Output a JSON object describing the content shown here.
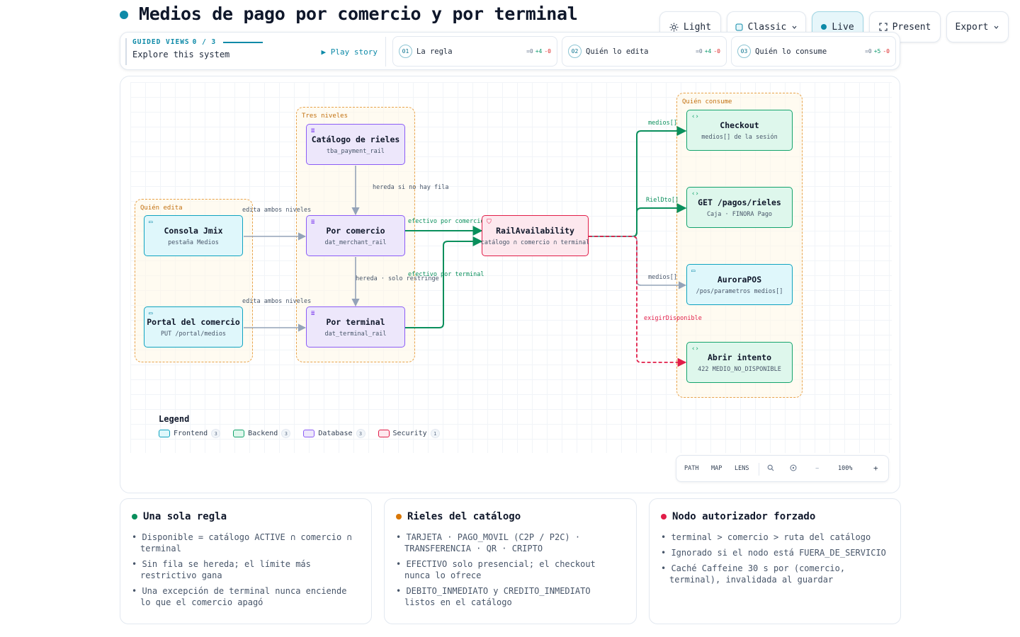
{
  "header": {
    "title": "Medios de pago por comercio y por terminal",
    "accent_color": "#0e8aa8"
  },
  "toolbar": {
    "light": "Light",
    "classic": "Classic",
    "live": "Live",
    "present": "Present",
    "export": "Export"
  },
  "guided": {
    "kicker": "GUIDED VIEWS",
    "progress": "0 / 3",
    "subtitle": "Explore this system",
    "play": "Play story",
    "steps": [
      {
        "num": "01",
        "label": "La regla",
        "eq": "=0",
        "plus": "+4",
        "minus": "-0"
      },
      {
        "num": "02",
        "label": "Quién lo edita",
        "eq": "=0",
        "plus": "+4",
        "minus": "-0"
      },
      {
        "num": "03",
        "label": "Quién lo consume",
        "eq": "=0",
        "plus": "+5",
        "minus": "-0"
      }
    ]
  },
  "diagram": {
    "groups": {
      "editors": "Quién edita",
      "levels": "Tres niveles",
      "consumers": "Quién consume"
    },
    "nodes": {
      "jmix": {
        "title": "Consola Jmix",
        "sub": "pestaña Medios",
        "kind": "frontend"
      },
      "portal": {
        "title": "Portal del comercio",
        "sub": "PUT /portal/medios",
        "kind": "frontend"
      },
      "catalog": {
        "title": "Catálogo de rieles",
        "sub": "tba_payment_rail",
        "kind": "database"
      },
      "merchant": {
        "title": "Por comercio",
        "sub": "dat_merchant_rail",
        "kind": "database"
      },
      "terminal": {
        "title": "Por terminal",
        "sub": "dat_terminal_rail",
        "kind": "database"
      },
      "rail": {
        "title": "RailAvailability",
        "sub": "catálogo ∩ comercio ∩ terminal",
        "kind": "security"
      },
      "checkout": {
        "title": "Checkout",
        "sub": "medios[] de la sesión",
        "kind": "backend"
      },
      "getpagos": {
        "title": "GET /pagos/rieles",
        "sub": "Caja · FINORA Pago",
        "kind": "backend"
      },
      "aurora": {
        "title": "AuroraPOS",
        "sub": "/pos/parametros medios[]",
        "kind": "frontend"
      },
      "intento": {
        "title": "Abrir intento",
        "sub": "422 MEDIO_NO_DISPONIBLE",
        "kind": "backend"
      }
    },
    "edges": {
      "jmix_merchant": "edita ambos niveles",
      "portal_terminal": "edita ambos niveles",
      "catalog_merchant": "hereda si no hay fila",
      "merchant_terminal": "hereda · solo restringe",
      "merchant_rail": "efectivo por comercio",
      "terminal_rail": "efectivo por terminal",
      "rail_checkout": "medios[]",
      "rail_get": "RielDto[]",
      "rail_aurora": "medios[]",
      "rail_intento": "exigirDisponible"
    },
    "legend": {
      "title": "Legend",
      "items": [
        {
          "label": "Frontend",
          "count": "3",
          "color": "#0fa3c0",
          "fill": "#dff7fb"
        },
        {
          "label": "Backend",
          "count": "3",
          "color": "#13a36c",
          "fill": "#def7ec"
        },
        {
          "label": "Database",
          "count": "3",
          "color": "#8b5cf6",
          "fill": "#ede7fb"
        },
        {
          "label": "Security",
          "count": "1",
          "color": "#e11d48",
          "fill": "#fde8ee"
        }
      ]
    },
    "controls": {
      "path": "PATH",
      "map": "MAP",
      "lens": "LENS",
      "zoom": "100%"
    }
  },
  "cards": [
    {
      "title": "Una sola regla",
      "color": "#0a8f5c",
      "items": [
        "Disponible = catálogo ACTIVE ∩ comercio ∩ terminal",
        "Sin fila se hereda; el límite más restrictivo gana",
        "Una excepción de terminal nunca enciende lo que el comercio apagó"
      ]
    },
    {
      "title": "Rieles del catálogo",
      "color": "#d97706",
      "items": [
        "TARJETA · PAGO_MOVIL (C2P / P2C) · TRANSFERENCIA · QR · CRIPTO",
        "EFECTIVO solo presencial; el checkout nunca lo ofrece",
        "DEBITO_INMEDIATO y CREDITO_INMEDIATO listos en el catálogo"
      ]
    },
    {
      "title": "Nodo autorizador forzado",
      "color": "#e11d48",
      "items": [
        "terminal > comercio > ruta del catálogo",
        "Ignorado si el nodo está FUERA_DE_SERVICIO",
        "Caché Caffeine 30 s por (comercio, terminal), invalidada al guardar"
      ]
    }
  ]
}
